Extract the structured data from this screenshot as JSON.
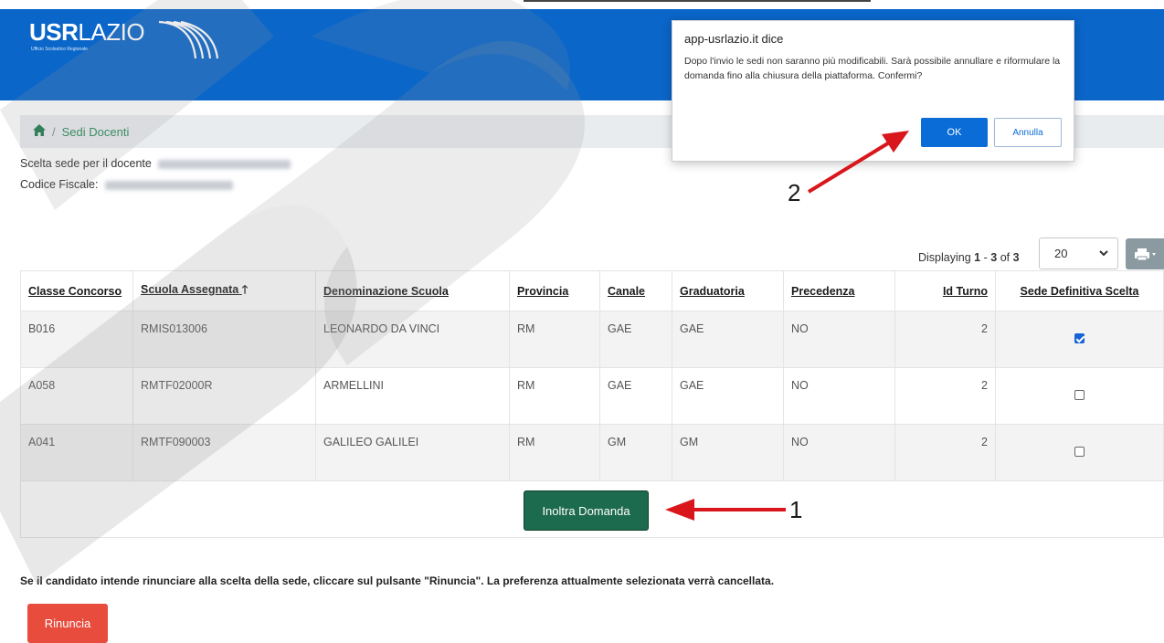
{
  "header": {
    "logo_bold": "USR",
    "logo_light": "LAZIO",
    "logo_sub": "Ufficio Scolastico Regionale",
    "bg_color": "#0a66c9"
  },
  "breadcrumb": {
    "home_icon": "home-icon",
    "separator": "/",
    "current": "Sedi Docenti"
  },
  "teacher": {
    "label": "Scelta sede per il docente",
    "fiscal_label": "Codice Fiscale:"
  },
  "pagination": {
    "displaying": "Displaying",
    "from": "1",
    "dash": "-",
    "to": "3",
    "of": "of",
    "total": "3",
    "page_size": "20",
    "print_icon": "print-icon"
  },
  "table": {
    "columns": [
      "Classe Concorso",
      "Scuola Assegnata",
      "Denominazione Scuola",
      "Provincia",
      "Canale",
      "Graduatoria",
      "Precedenza",
      "Id Turno",
      "Sede Definitiva Scelta"
    ],
    "sort_arrow": "🡑",
    "rows": [
      {
        "classe": "B016",
        "scuola": "RMIS013006",
        "denominazione": "LEONARDO DA VINCI",
        "provincia": "RM",
        "canale": "GAE",
        "graduatoria": "GAE",
        "precedenza": "NO",
        "turno": "2",
        "checked": true
      },
      {
        "classe": "A058",
        "scuola": "RMTF02000R",
        "denominazione": "ARMELLINI",
        "provincia": "RM",
        "canale": "GAE",
        "graduatoria": "GAE",
        "precedenza": "NO",
        "turno": "2",
        "checked": false
      },
      {
        "classe": "A041",
        "scuola": "RMTF090003",
        "denominazione": "GALILEO GALILEI",
        "provincia": "RM",
        "canale": "GM",
        "graduatoria": "GM",
        "precedenza": "NO",
        "turno": "2",
        "checked": false
      }
    ]
  },
  "actions": {
    "inoltra_label": "Inoltra Domanda",
    "note": "Se il candidato intende rinunciare alla scelta della sede, cliccare sul pulsante \"Rinuncia\". La preferenza attualmente selezionata verrà cancellata.",
    "rinuncia_label": "Rinuncia",
    "inoltra_color": "#1d6b4e",
    "rinuncia_color": "#e84c3d"
  },
  "dialog": {
    "title": "app-usrlazio.it dice",
    "message": "Dopo l'invio le sedi non saranno più modificabili. Sarà possibile annullare e riformulare la domanda fino alla chiusura della piattaforma. Confermi?",
    "ok_label": "OK",
    "cancel_label": "Annulla",
    "ok_color": "#0a6cd6"
  },
  "annotations": {
    "step1": "1",
    "step2": "2",
    "arrow_color": "#d9161b"
  }
}
